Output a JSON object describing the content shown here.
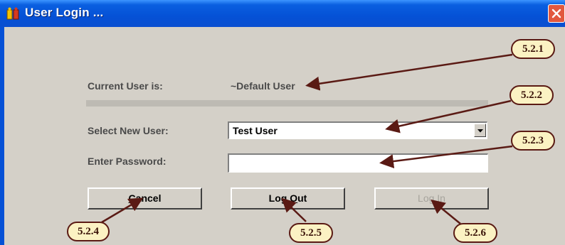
{
  "window": {
    "title": "User Login ...",
    "icons": {
      "app": "user-login-icon",
      "close": "close-icon"
    }
  },
  "form": {
    "current_user_label": "Current User is:",
    "current_user_value": "~Default User",
    "select_user_label": "Select New User:",
    "selected_user": "Test User",
    "password_label": "Enter Password:",
    "password_value": ""
  },
  "buttons": {
    "cancel": {
      "pre": "",
      "key": "C",
      "post": "ancel"
    },
    "logout": {
      "pre": "Log ",
      "key": "O",
      "post": "ut"
    },
    "login": "Log In"
  },
  "callouts": {
    "c1": "5.2.1",
    "c2": "5.2.2",
    "c3": "5.2.3",
    "c4": "5.2.4",
    "c5": "5.2.5",
    "c6": "5.2.6"
  },
  "colors": {
    "titlebar": "#0551d6",
    "dialog_bg": "#d4d0c8",
    "close_button": "#e2583e",
    "callout_fill": "#fbf2c3",
    "callout_border": "#5a1a14",
    "arrow": "#5a1a14"
  }
}
